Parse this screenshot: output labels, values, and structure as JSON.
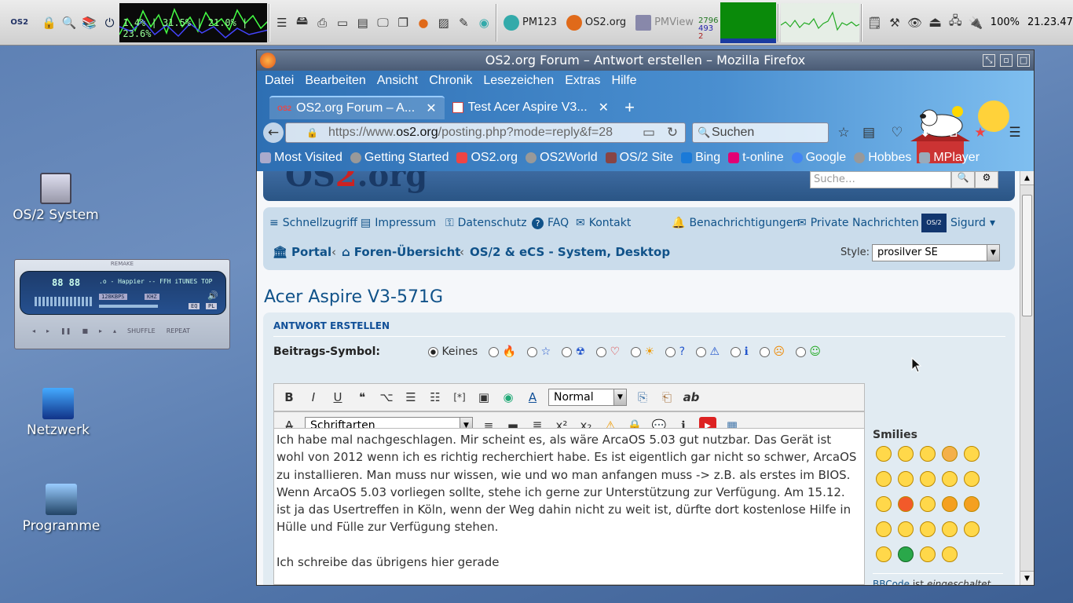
{
  "taskbar": {
    "cpu_text": "1.4% | 31.5% | 21.0% | 23.6%",
    "tasks": [
      {
        "label": "PM123",
        "color": "#3aa"
      },
      {
        "label": "OS2.org",
        "color": "#e06a1a"
      },
      {
        "label": "PMView",
        "color": "#88a"
      }
    ],
    "mem_numbers": [
      "2796",
      "493",
      "2"
    ],
    "battery": "100%",
    "clock": "21.23.47"
  },
  "desktop": {
    "icons": [
      {
        "label": "OS/2 System"
      },
      {
        "label": "Netzwerk"
      },
      {
        "label": "Programme"
      }
    ]
  },
  "player": {
    "title": "REMAKE",
    "time": "88 88",
    "track": ".o - Happier -- FFH iTUNES TOP",
    "bitrate": "128KBPS",
    "khz": "KHZ",
    "eq": "EQ",
    "pl": "PL",
    "shuffle": "SHUFFLE",
    "repeat": "REPEAT"
  },
  "browser": {
    "window_title": "OS2.org Forum – Antwort erstellen – Mozilla Firefox",
    "menu": [
      "Datei",
      "Bearbeiten",
      "Ansicht",
      "Chronik",
      "Lesezeichen",
      "Extras",
      "Hilfe"
    ],
    "tabs": [
      {
        "label": "OS2.org Forum – A..."
      },
      {
        "label": "Test Acer Aspire V3..."
      }
    ],
    "new_tab": "+",
    "url_prefix": "https://www.",
    "url_domain": "os2.org",
    "url_rest": "/posting.php?mode=reply&f=28",
    "search_placeholder": "Suchen",
    "bookmarks": [
      {
        "label": "Most Visited",
        "color": "#aac"
      },
      {
        "label": "Getting Started",
        "color": "#999"
      },
      {
        "label": "OS2.org",
        "color": "#e44"
      },
      {
        "label": "OS2World",
        "color": "#999"
      },
      {
        "label": "OS/2 Site",
        "color": "#844"
      },
      {
        "label": "Bing",
        "color": "#1a7ad8"
      },
      {
        "label": "t-online",
        "color": "#e20074"
      },
      {
        "label": "Google",
        "color": "#4285f4"
      },
      {
        "label": "Hobbes",
        "color": "#999"
      },
      {
        "label": "MPlayer",
        "color": "#9ab"
      }
    ]
  },
  "forum": {
    "search_placeholder": "Suche…",
    "quicklinks": [
      {
        "label": "Schnellzugriff",
        "icon": "≡"
      },
      {
        "label": "Impressum",
        "icon": "▤"
      },
      {
        "label": "Datenschutz",
        "icon": "⚿"
      },
      {
        "label": "FAQ",
        "icon": "?"
      },
      {
        "label": "Kontakt",
        "icon": "✉"
      }
    ],
    "notifications": "Benachrichtigungen",
    "messages": "Private Nachrichten",
    "user": "Sigurd",
    "breadcrumbs": [
      "Portal",
      "Foren-Übersicht",
      "OS/2 & eCS - System, Desktop"
    ],
    "style_label": "Style:",
    "style_value": "prosilver SE",
    "topic_title": "Acer Aspire V3-571G",
    "section_title": "ANTWORT ERSTELLEN",
    "post_icon_label": "Beitrags-Symbol:",
    "post_icon_none": "Keines",
    "post_icons": [
      {
        "glyph": "🔥",
        "color": "#e90"
      },
      {
        "glyph": "☆",
        "color": "#25c"
      },
      {
        "glyph": "☢",
        "color": "#25c"
      },
      {
        "glyph": "♡",
        "color": "#d22"
      },
      {
        "glyph": "☀",
        "color": "#e90"
      },
      {
        "glyph": "?",
        "color": "#25c"
      },
      {
        "glyph": "⚠",
        "color": "#25c"
      },
      {
        "glyph": "ℹ",
        "color": "#25c"
      },
      {
        "glyph": "☹",
        "color": "#e80"
      },
      {
        "glyph": "☺",
        "color": "#2a2"
      }
    ],
    "toolbar_row1": [
      "B",
      "I",
      "U",
      "❝",
      "⌥",
      "☰",
      "☷",
      "[*]",
      "▣",
      "◉",
      "A"
    ],
    "font_size_select": "Normal",
    "toolbar_row1_end": [
      "⎘",
      "⎗",
      "ab"
    ],
    "toolbar_row2_start": "A̶",
    "font_select": "Schriftarten",
    "toolbar_row2": [
      "≡",
      "▬",
      "≣",
      "x²",
      "x₂",
      "⚠",
      "🔒",
      "💬",
      "ℹ",
      "▶",
      "▦"
    ],
    "editor_text": "Ich habe mal nachgeschlagen. Mir scheint es, als wäre ArcaOS 5.03 gut nutzbar. Das Gerät ist wohl von 2012 wenn ich es richtig recherchiert habe. Es ist eigentlich gar nicht so schwer, ArcaOS zu installieren. Man muss nur wissen, wie und wo man anfangen muss -> z.B. als erstes im BIOS. Wenn ArcaOS 5.03 vorliegen sollte, stehe ich gerne zur Unterstützung zur Verfügung. Am 15.12. ist ja das Usertreffen in Köln, wenn der Weg dahin nicht zu weit ist, dürfte dort kostenlose Hilfe in Hülle und Fülle zur Verfügung stehen.",
    "editor_text2": "Ich schreibe das übrigens hier gerade",
    "smilies_title": "Smilies",
    "bbcode_label": "BBCode",
    "bbcode_is": "ist",
    "bbcode_state": "eingeschaltet"
  }
}
